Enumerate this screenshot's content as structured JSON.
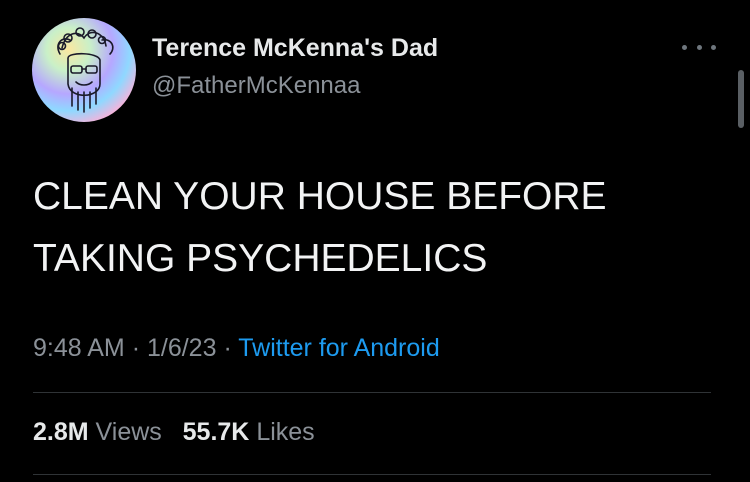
{
  "author": {
    "display_name": "Terence McKenna's Dad",
    "handle": "@FatherMcKennaa"
  },
  "tweet": {
    "lines": [
      "CLEAN YOUR HOUSE BEFORE",
      "TAKING PSYCHEDELICS"
    ],
    "time": "9:48 AM",
    "date": "1/6/23",
    "separator": "·",
    "client": "Twitter for Android"
  },
  "stats": {
    "views_value": "2.8M",
    "views_label": "Views",
    "likes_value": "55.7K",
    "likes_label": "Likes"
  },
  "colors": {
    "background": "#000000",
    "link": "#1d9bf0",
    "muted": "#8b9198"
  },
  "icons": {
    "more": "more-horizontal-icon"
  }
}
